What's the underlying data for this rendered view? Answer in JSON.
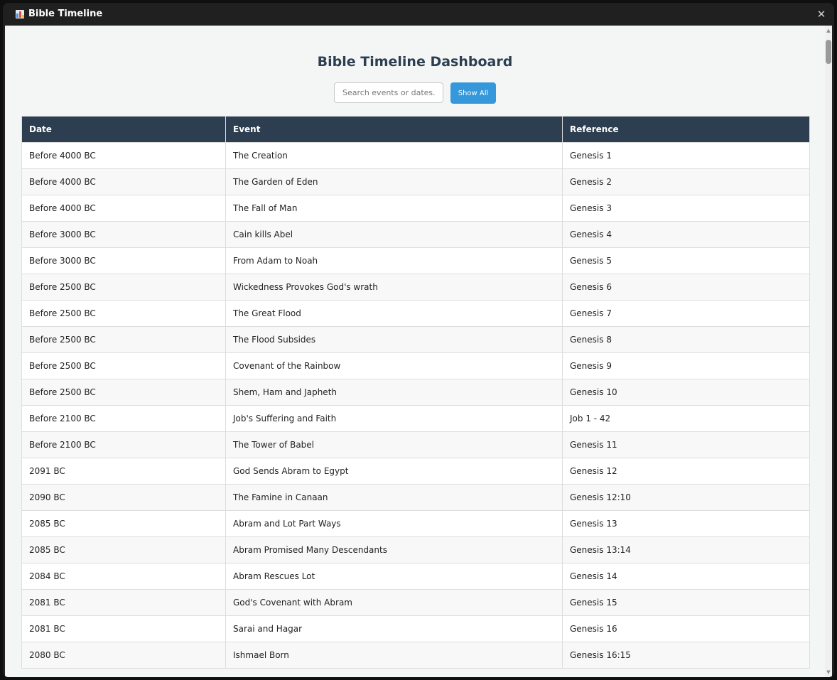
{
  "window": {
    "title": "Bible Timeline",
    "close_glyph": "✕"
  },
  "page": {
    "heading": "Bible Timeline Dashboard"
  },
  "search": {
    "placeholder": "Search events or dates...",
    "value": ""
  },
  "toolbar": {
    "show_all_label": "Show All"
  },
  "table": {
    "columns": [
      "Date",
      "Event",
      "Reference"
    ],
    "rows": [
      {
        "date": "Before 4000 BC",
        "event": "The Creation",
        "reference": "Genesis 1"
      },
      {
        "date": "Before 4000 BC",
        "event": "The Garden of Eden",
        "reference": "Genesis 2"
      },
      {
        "date": "Before 4000 BC",
        "event": "The Fall of Man",
        "reference": "Genesis 3"
      },
      {
        "date": "Before 3000 BC",
        "event": "Cain kills Abel",
        "reference": "Genesis 4"
      },
      {
        "date": "Before 3000 BC",
        "event": "From Adam to Noah",
        "reference": "Genesis 5"
      },
      {
        "date": "Before 2500 BC",
        "event": "Wickedness Provokes God's wrath",
        "reference": "Genesis 6"
      },
      {
        "date": "Before 2500 BC",
        "event": "The Great Flood",
        "reference": "Genesis 7"
      },
      {
        "date": "Before 2500 BC",
        "event": "The Flood Subsides",
        "reference": "Genesis 8"
      },
      {
        "date": "Before 2500 BC",
        "event": "Covenant of the Rainbow",
        "reference": "Genesis 9"
      },
      {
        "date": "Before 2500 BC",
        "event": "Shem, Ham and Japheth",
        "reference": "Genesis 10"
      },
      {
        "date": "Before 2100 BC",
        "event": "Job's Suffering and Faith",
        "reference": "Job 1 - 42"
      },
      {
        "date": "Before 2100 BC",
        "event": "The Tower of Babel",
        "reference": "Genesis 11"
      },
      {
        "date": "2091 BC",
        "event": "God Sends Abram to Egypt",
        "reference": "Genesis 12"
      },
      {
        "date": "2090 BC",
        "event": "The Famine in Canaan",
        "reference": "Genesis 12:10"
      },
      {
        "date": "2085 BC",
        "event": "Abram and Lot Part Ways",
        "reference": "Genesis 13"
      },
      {
        "date": "2085 BC",
        "event": "Abram Promised Many Descendants",
        "reference": "Genesis 13:14"
      },
      {
        "date": "2084 BC",
        "event": "Abram Rescues Lot",
        "reference": "Genesis 14"
      },
      {
        "date": "2081 BC",
        "event": "God's Covenant with Abram",
        "reference": "Genesis 15"
      },
      {
        "date": "2081 BC",
        "event": "Sarai and Hagar",
        "reference": "Genesis 16"
      },
      {
        "date": "2080 BC",
        "event": "Ishmael Born",
        "reference": "Genesis 16:15"
      }
    ]
  },
  "icons": {
    "app": "bar-chart-icon",
    "close": "close-icon"
  }
}
